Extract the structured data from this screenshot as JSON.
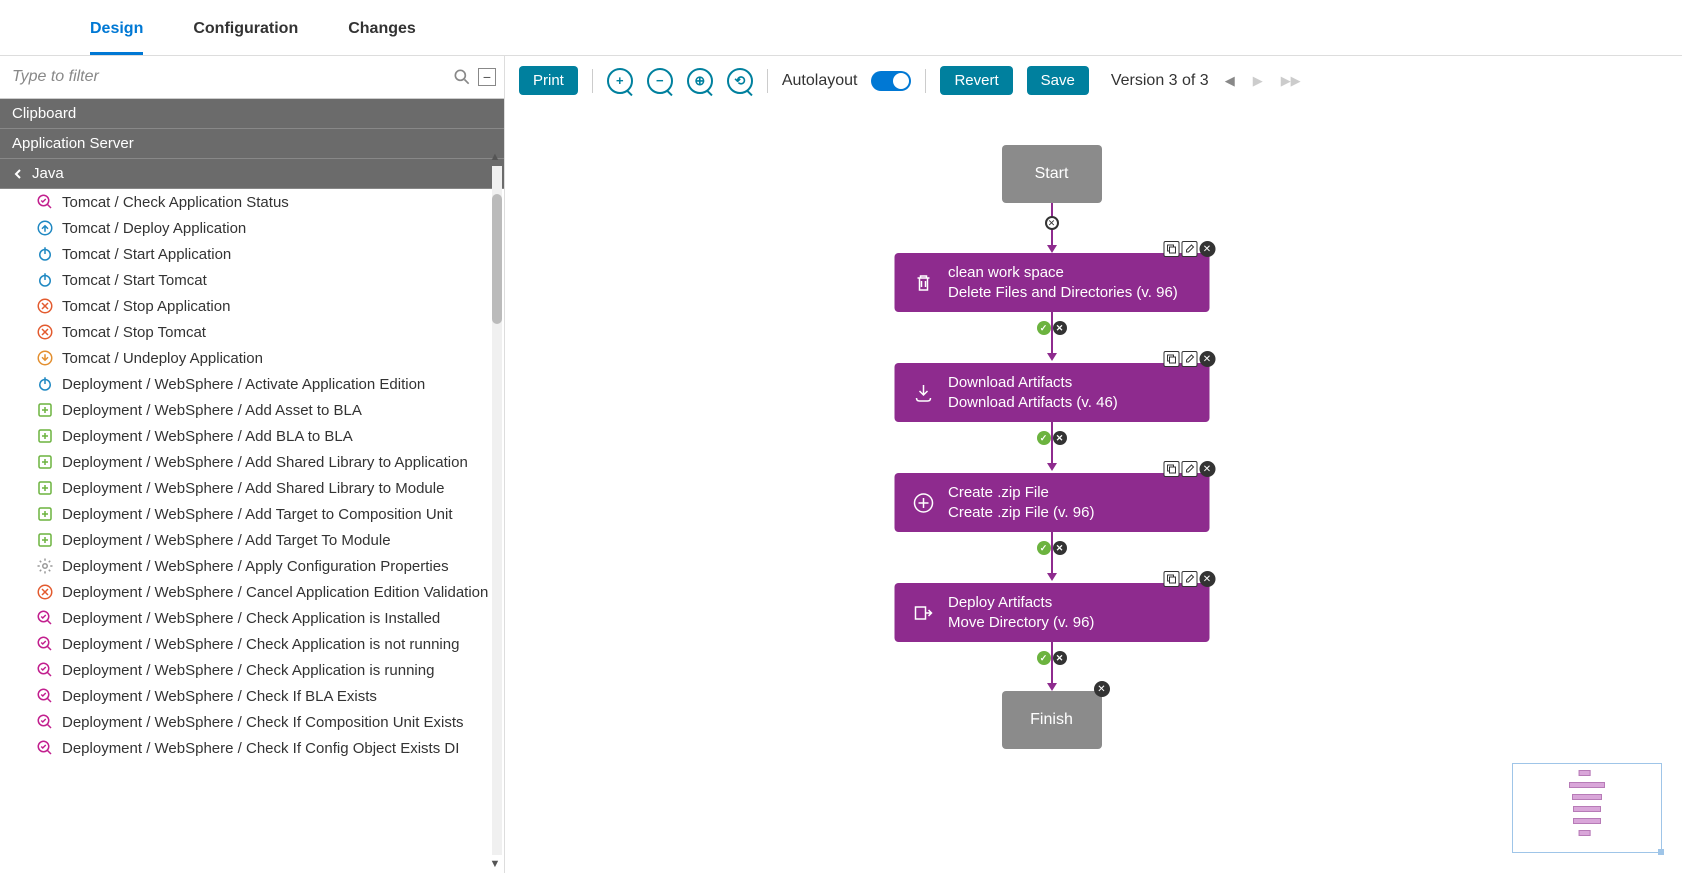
{
  "tabs": {
    "design": "Design",
    "configuration": "Configuration",
    "changes": "Changes"
  },
  "filter": {
    "placeholder": "Type to filter"
  },
  "sidebarCategories": {
    "clipboard": "Clipboard",
    "appServer": "Application Server",
    "java": "Java"
  },
  "palette": [
    {
      "icon": "check-magnify",
      "color": "#c21f8e",
      "label": "Tomcat / Check Application Status"
    },
    {
      "icon": "deploy",
      "color": "#1f88c2",
      "label": "Tomcat / Deploy Application"
    },
    {
      "icon": "power",
      "color": "#1f88c2",
      "label": "Tomcat / Start Application"
    },
    {
      "icon": "power",
      "color": "#1f88c2",
      "label": "Tomcat / Start Tomcat"
    },
    {
      "icon": "stop-x",
      "color": "#e35b2f",
      "label": "Tomcat / Stop Application"
    },
    {
      "icon": "stop-x",
      "color": "#e35b2f",
      "label": "Tomcat / Stop Tomcat"
    },
    {
      "icon": "undeploy",
      "color": "#e38f2f",
      "label": "Tomcat / Undeploy Application"
    },
    {
      "icon": "power",
      "color": "#1f88c2",
      "label": "Deployment / WebSphere / Activate Application Edition"
    },
    {
      "icon": "add-box",
      "color": "#6cb33f",
      "label": "Deployment / WebSphere / Add Asset to BLA"
    },
    {
      "icon": "add-box",
      "color": "#6cb33f",
      "label": "Deployment / WebSphere / Add BLA to BLA"
    },
    {
      "icon": "add-box",
      "color": "#6cb33f",
      "label": "Deployment / WebSphere / Add Shared Library to Application"
    },
    {
      "icon": "add-box",
      "color": "#6cb33f",
      "label": "Deployment / WebSphere / Add Shared Library to Module"
    },
    {
      "icon": "add-box",
      "color": "#6cb33f",
      "label": "Deployment / WebSphere / Add Target to Composition Unit"
    },
    {
      "icon": "add-box",
      "color": "#6cb33f",
      "label": "Deployment / WebSphere / Add Target To Module"
    },
    {
      "icon": "gear",
      "color": "#999",
      "label": "Deployment / WebSphere / Apply Configuration Properties"
    },
    {
      "icon": "stop-x",
      "color": "#e35b2f",
      "label": "Deployment / WebSphere / Cancel Application Edition Validation"
    },
    {
      "icon": "check-magnify",
      "color": "#c21f8e",
      "label": "Deployment / WebSphere / Check Application is Installed"
    },
    {
      "icon": "check-magnify",
      "color": "#c21f8e",
      "label": "Deployment / WebSphere / Check Application is not running"
    },
    {
      "icon": "check-magnify",
      "color": "#c21f8e",
      "label": "Deployment / WebSphere / Check Application is running"
    },
    {
      "icon": "check-magnify",
      "color": "#c21f8e",
      "label": "Deployment / WebSphere / Check If BLA Exists"
    },
    {
      "icon": "check-magnify",
      "color": "#c21f8e",
      "label": "Deployment / WebSphere / Check If Composition Unit Exists"
    },
    {
      "icon": "check-magnify",
      "color": "#c21f8e",
      "label": "Deployment / WebSphere / Check If Config Object Exists DI"
    }
  ],
  "toolbar": {
    "print": "Print",
    "autolayout": "Autolayout",
    "revert": "Revert",
    "save": "Save",
    "version": "Version 3 of 3"
  },
  "flow": {
    "start": "Start",
    "finish": "Finish",
    "steps": [
      {
        "title": "clean work space",
        "subtitle": "Delete Files and Directories (v. 96)",
        "icon": "trash"
      },
      {
        "title": "Download Artifacts",
        "subtitle": "Download Artifacts (v. 46)",
        "icon": "download"
      },
      {
        "title": "Create .zip File",
        "subtitle": "Create .zip File (v. 96)",
        "icon": "plus-circle"
      },
      {
        "title": "Deploy Artifacts",
        "subtitle": "Move Directory (v. 96)",
        "icon": "arrow-out"
      }
    ]
  }
}
